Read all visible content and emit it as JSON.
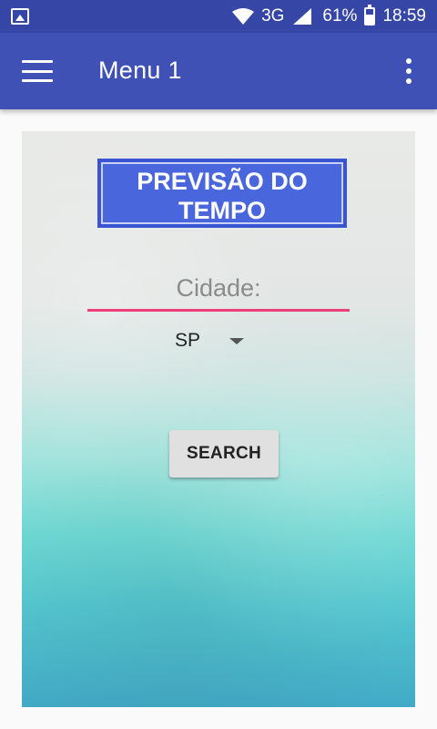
{
  "status_bar": {
    "network": "3G",
    "battery_percent": "61%",
    "battery_level": 0.61,
    "time": "18:59",
    "icons": [
      "gallery-icon",
      "wifi-icon",
      "signal-icon",
      "battery-icon"
    ]
  },
  "app_bar": {
    "title": "Menu 1",
    "icons": [
      "hamburger-menu-icon",
      "overflow-menu-icon"
    ]
  },
  "main": {
    "heading": "PREVISÃO DO TEMPO",
    "city_field": {
      "placeholder": "Cidade:",
      "value": ""
    },
    "state_select": {
      "selected": "SP"
    },
    "search_button_label": "SEARCH"
  },
  "colors": {
    "status_bar": "#3646a6",
    "app_bar": "#3f51b5",
    "title_box": "#4a66dd",
    "input_underline": "#ec407a",
    "button": "#e0e0e0"
  }
}
